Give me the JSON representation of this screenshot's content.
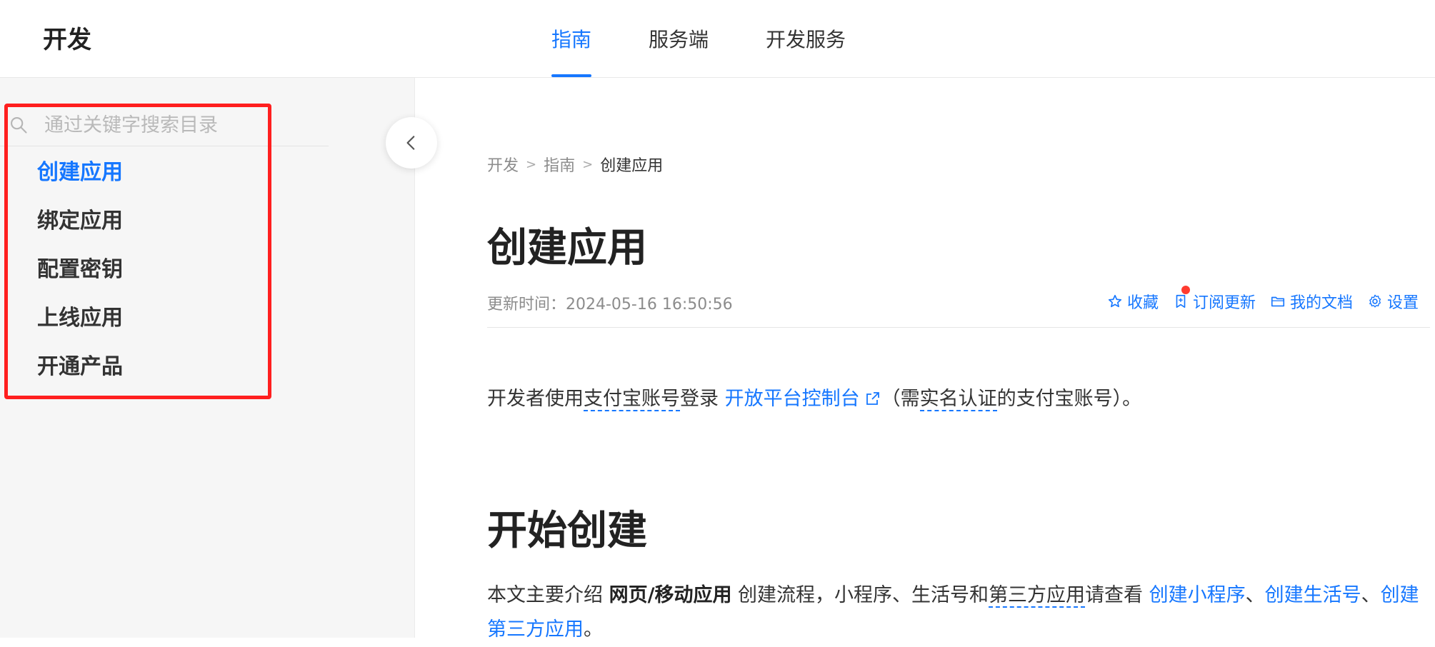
{
  "header": {
    "brand": "开发",
    "tabs": [
      {
        "label": "指南"
      },
      {
        "label": "服务端"
      },
      {
        "label": "开发服务"
      }
    ]
  },
  "sidebar": {
    "search_placeholder": "通过关键字搜索目录",
    "items": [
      {
        "label": "创建应用"
      },
      {
        "label": "绑定应用"
      },
      {
        "label": "配置密钥"
      },
      {
        "label": "上线应用"
      },
      {
        "label": "开通产品"
      }
    ]
  },
  "content": {
    "breadcrumb": {
      "root": "开发",
      "parent": "指南",
      "current": "创建应用",
      "sep": ">"
    },
    "title": "创建应用",
    "updated": "更新时间：2024-05-16 16:50:56",
    "actions": {
      "favorite": "收藏",
      "subscribe": "订阅更新",
      "my_docs": "我的文档",
      "settings": "设置"
    },
    "para1": {
      "t1": "开发者使用",
      "term1": "支付宝账号",
      "t2": "登录 ",
      "link": "开放平台控制台",
      "t3": "（需",
      "term2": "实名认证",
      "t4": "的支付宝账号）。"
    },
    "section_title": "开始创建",
    "para2": {
      "t1": "本文主要介绍 ",
      "bold": "网页/移动应用",
      "t2": " 创建流程，小程序、生活号和",
      "term": "第三方应用",
      "t3": "请查看 ",
      "link1": "创建小程序",
      "sep1": "、",
      "link2": "创建生活号",
      "sep2": "、",
      "link3": "创建第三方应用",
      "end": "。"
    }
  },
  "colors": {
    "accent": "#1677ff",
    "highlight": "#ff1f1f",
    "badge": "#ff3b30"
  }
}
